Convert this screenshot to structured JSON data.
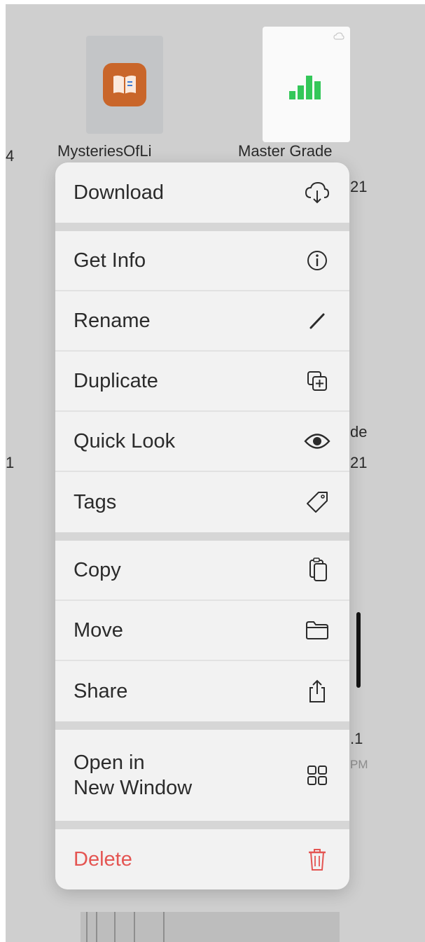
{
  "files": {
    "book": {
      "name": "MysteriesOfLi",
      "icon": "book-icon"
    },
    "sheet": {
      "name": "Master Grade",
      "icon": "bar-chart-icon"
    }
  },
  "background_fragments": {
    "row1_left": "4",
    "row1_right_line2": "21",
    "row2_right_line1": "de",
    "row2_right_line2": "21",
    "row2_left": "1",
    "row3_right_line1": ".1",
    "row3_right_line2": "PM"
  },
  "menu": {
    "groups": [
      [
        {
          "label": "Download",
          "icon": "cloud-download-icon"
        }
      ],
      [
        {
          "label": "Get Info",
          "icon": "info-icon"
        },
        {
          "label": "Rename",
          "icon": "pencil-icon"
        },
        {
          "label": "Duplicate",
          "icon": "duplicate-icon"
        },
        {
          "label": "Quick Look",
          "icon": "eye-icon"
        },
        {
          "label": "Tags",
          "icon": "tag-icon"
        }
      ],
      [
        {
          "label": "Copy",
          "icon": "copy-icon"
        },
        {
          "label": "Move",
          "icon": "folder-icon"
        },
        {
          "label": "Share",
          "icon": "share-icon"
        }
      ],
      [
        {
          "label": "Open in\nNew Window",
          "icon": "grid-window-icon"
        }
      ],
      [
        {
          "label": "Delete",
          "icon": "trash-icon",
          "destructive": true
        }
      ]
    ]
  },
  "colors": {
    "destructive": "#e45552",
    "menu_background": "#f2f2f2",
    "book_icon": "#c9662a",
    "chart_green": "#34c759"
  }
}
